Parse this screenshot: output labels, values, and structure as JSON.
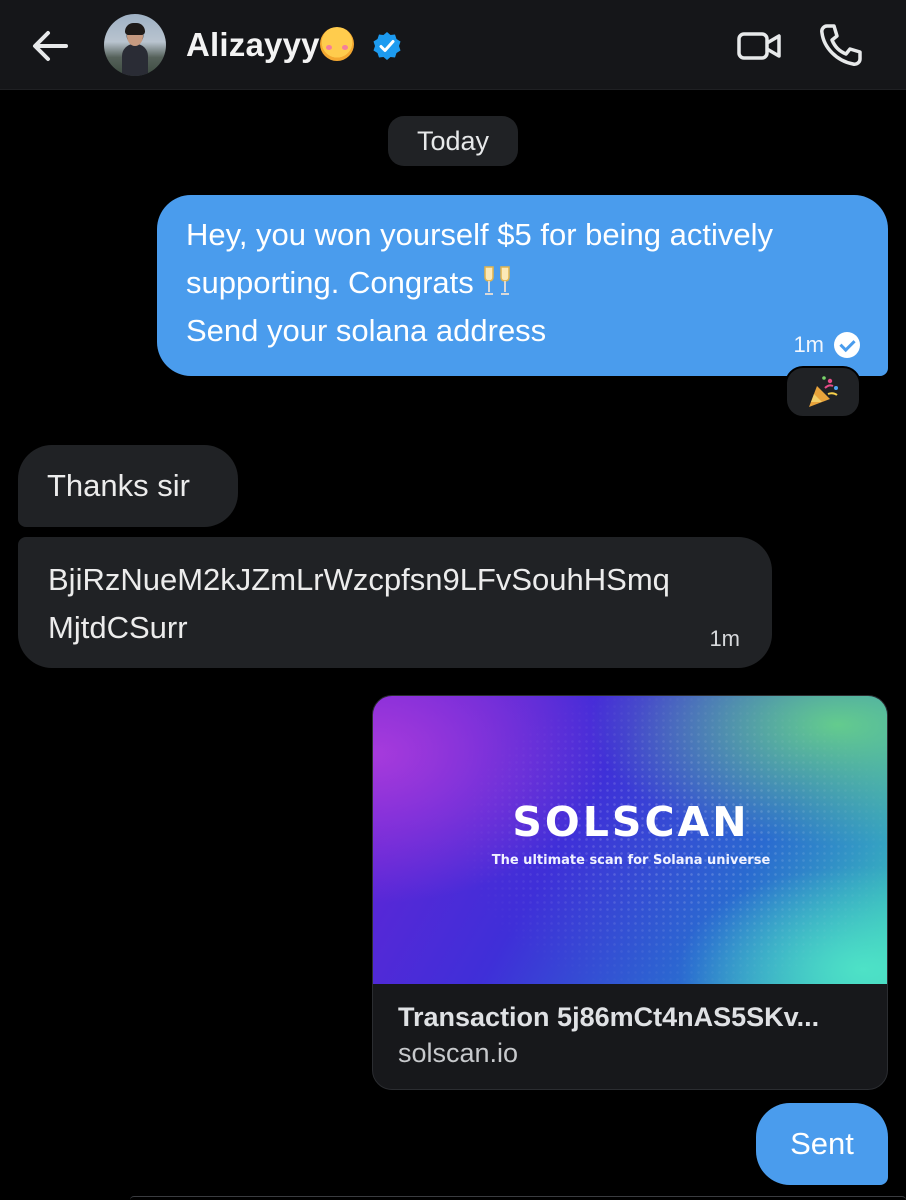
{
  "header": {
    "contact_name": "Alizayyy",
    "name_emoji": "smiling-face-with-hearts",
    "verified": true,
    "icons": [
      "back-arrow-icon",
      "video-camera-icon",
      "phone-icon"
    ],
    "accent_color": "#1d9bf0"
  },
  "conversation": {
    "date_divider": "Today",
    "messages": [
      {
        "direction": "sent",
        "lines": [
          "Hey, you won yourself $5 for being actively",
          "supporting. Congrats",
          "Send your solana address"
        ],
        "emoji": "clinking-glasses",
        "time": "1m",
        "status": "read",
        "reaction": "party-popper"
      },
      {
        "direction": "received",
        "text": "Thanks sir"
      },
      {
        "direction": "received",
        "lines": [
          "BjiRzNueM2kJZmLrWzcpfsn9LFvSouhHSmq",
          "MjtdCSurr"
        ],
        "time": "1m"
      },
      {
        "direction": "sent",
        "type": "link-card",
        "card": {
          "logo_text": "SOLSCAN",
          "tagline": "The ultimate scan for Solana universe",
          "title": "Transaction 5j86mCt4nAS5SKv...",
          "domain": "solscan.io"
        }
      },
      {
        "direction": "sent",
        "text": "Sent"
      }
    ]
  },
  "colors": {
    "sent_bubble": "#4a9ced",
    "received_bubble": "#202225",
    "background": "#000000",
    "header_background": "#151619"
  }
}
